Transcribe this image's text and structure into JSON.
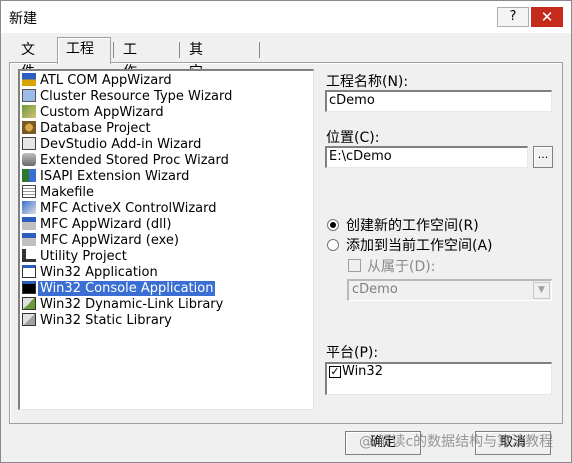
{
  "window": {
    "title": "新建",
    "help_label": "?",
    "close_label": "✕"
  },
  "tabs": [
    {
      "label": "文件"
    },
    {
      "label": "工程"
    },
    {
      "label": "工作区"
    },
    {
      "label": "其它文档"
    }
  ],
  "active_tab": "工程",
  "project_types": [
    {
      "label": "ATL COM AppWizard",
      "icon": "atl-icon"
    },
    {
      "label": "Cluster Resource Type Wizard",
      "icon": "cluster-icon"
    },
    {
      "label": "Custom AppWizard",
      "icon": "custom-wizard-icon"
    },
    {
      "label": "Database Project",
      "icon": "database-icon"
    },
    {
      "label": "DevStudio Add-in Wizard",
      "icon": "addin-icon"
    },
    {
      "label": "Extended Stored Proc Wizard",
      "icon": "stored-proc-icon"
    },
    {
      "label": "ISAPI Extension Wizard",
      "icon": "isapi-icon"
    },
    {
      "label": "Makefile",
      "icon": "makefile-icon"
    },
    {
      "label": "MFC ActiveX ControlWizard",
      "icon": "activex-icon"
    },
    {
      "label": "MFC AppWizard (dll)",
      "icon": "mfc-dll-icon"
    },
    {
      "label": "MFC AppWizard (exe)",
      "icon": "mfc-exe-icon"
    },
    {
      "label": "Utility Project",
      "icon": "utility-icon"
    },
    {
      "label": "Win32 Application",
      "icon": "win32-app-icon"
    },
    {
      "label": "Win32 Console Application",
      "icon": "console-icon"
    },
    {
      "label": "Win32 Dynamic-Link Library",
      "icon": "dll-icon"
    },
    {
      "label": "Win32 Static Library",
      "icon": "static-lib-icon"
    }
  ],
  "selected_project_type": "Win32 Console Application",
  "project_name": {
    "label": "工程名称(N):",
    "value": "cDemo"
  },
  "location": {
    "label": "位置(C):",
    "value": "E:\\cDemo",
    "browse_label": "..."
  },
  "workspace_options": {
    "create_new": {
      "label": "创建新的工作空间(R)",
      "selected": true
    },
    "add_to_current": {
      "label": "添加到当前工作空间(A)",
      "selected": false
    },
    "depends_on": {
      "label": "从属于(D):",
      "checked": false,
      "enabled": false
    },
    "dependency_value": "cDemo"
  },
  "platform": {
    "label": "平台(P):",
    "items": [
      {
        "label": "Win32",
        "checked": true,
        "check_mark": "✓"
      }
    ]
  },
  "buttons": {
    "ok": "确定",
    "cancel": "取消"
  },
  "watermark": "@ 解读c的数据结构与算法教程",
  "colors": {
    "selection": "#3a6ed2",
    "close_button": "#c42b1c"
  }
}
